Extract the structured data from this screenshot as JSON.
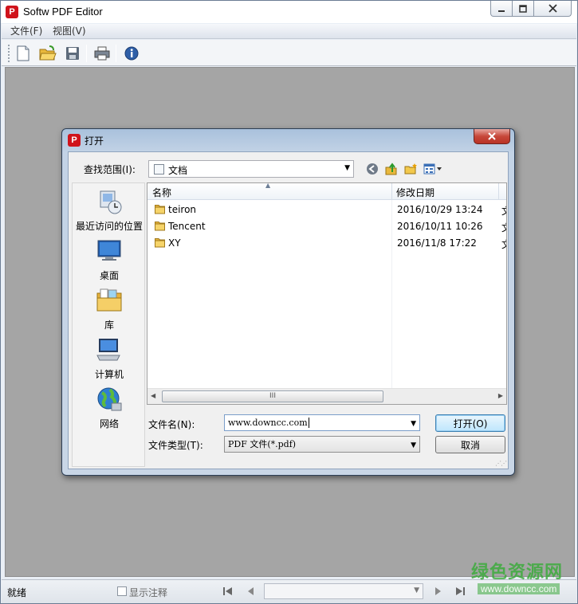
{
  "window": {
    "title": "Softw PDF Editor",
    "min": "▭",
    "max": "□",
    "close": "✕",
    "icon_letter": "P"
  },
  "menu": [
    {
      "label": "文件(F)"
    },
    {
      "label": "视图(V)"
    }
  ],
  "toolbar": {
    "icons": [
      "new-document-icon",
      "open-folder-icon",
      "save-disk-icon",
      "print-icon",
      "info-icon"
    ]
  },
  "status": {
    "text": "就绪",
    "annotation_label": "显示注释",
    "watermark_cn": "绿色资源网",
    "watermark_url": "www.downcc.com"
  },
  "dialog": {
    "title": "打开",
    "icon_letter": "P",
    "close": "✕",
    "lookin_label": "查找范围(I):",
    "lookin_value": "文档",
    "places": [
      {
        "label": "最近访问的位置"
      },
      {
        "label": "桌面"
      },
      {
        "label": "库"
      },
      {
        "label": "计算机"
      },
      {
        "label": "网络"
      }
    ],
    "columns": {
      "name": "名称",
      "modified": "修改日期"
    },
    "files": [
      {
        "name": "teiron",
        "modified": "2016/10/29 13:24",
        "tail": "文"
      },
      {
        "name": "Tencent",
        "modified": "2016/10/11 10:26",
        "tail": "文"
      },
      {
        "name": "XY",
        "modified": "2016/11/8 17:22",
        "tail": "文"
      }
    ],
    "scroll_thumb": "III",
    "filename_label": "文件名(N):",
    "filename_value": "www.downcc.com",
    "filetype_label": "文件类型(T):",
    "filetype_value": "PDF 文件(*.pdf)",
    "open_button": "打开(O)",
    "cancel_button": "取消"
  },
  "colors": {
    "accent_red": "#d0131b",
    "workspace_gray": "#a5a5a5",
    "watermark_green": "#3caa3c"
  }
}
